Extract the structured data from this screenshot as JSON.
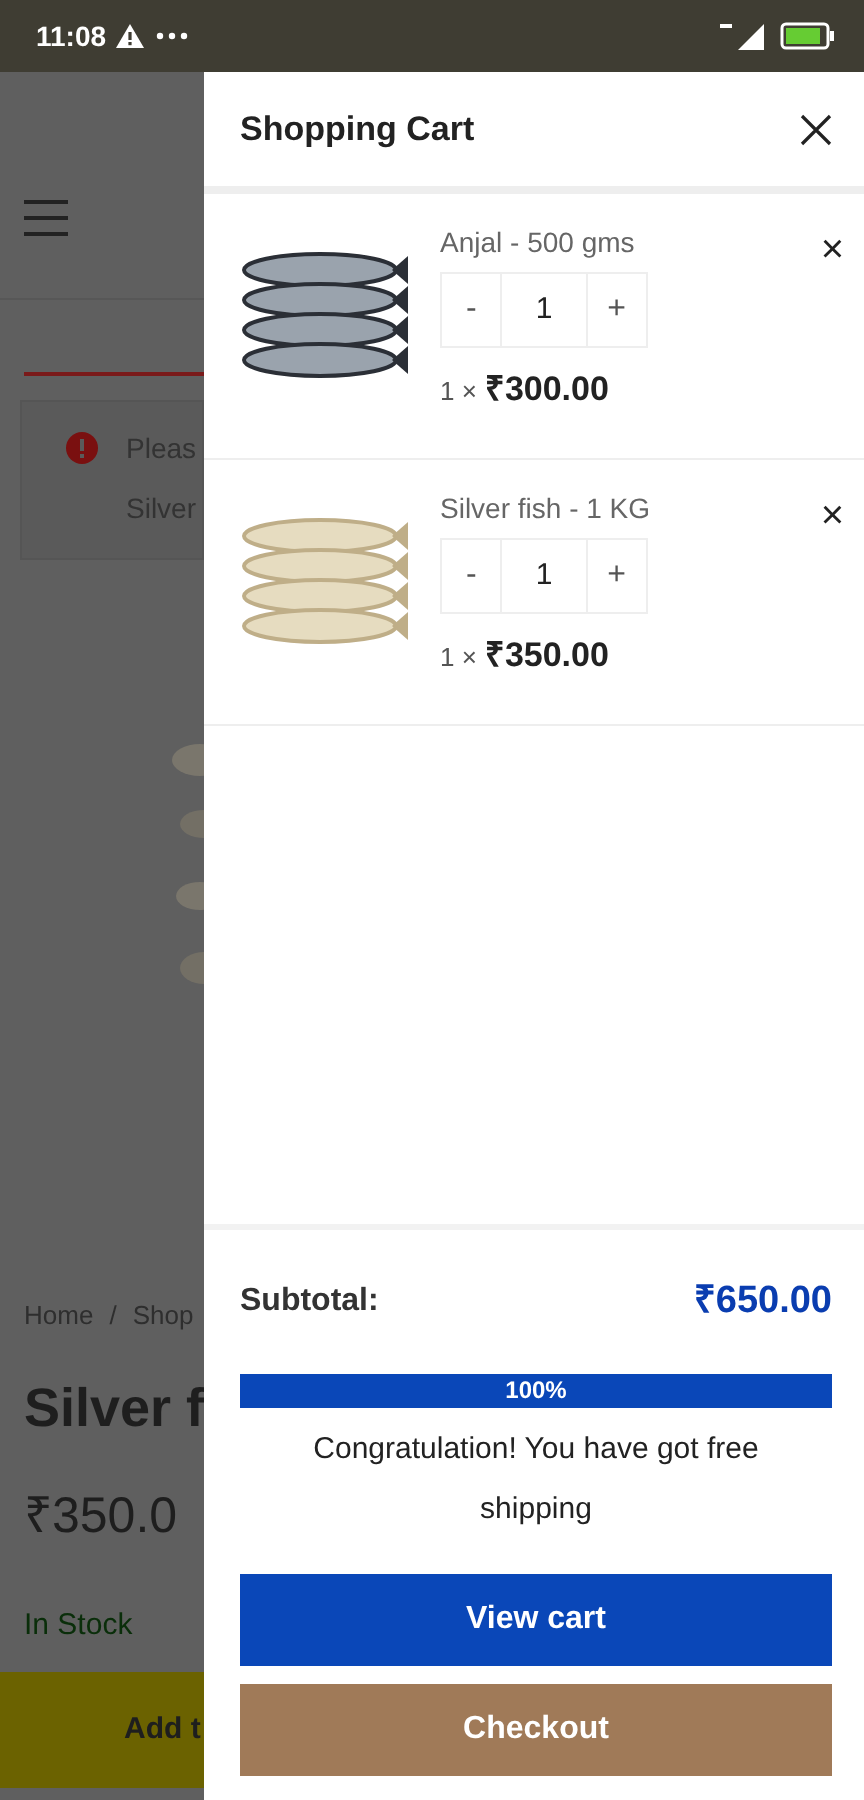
{
  "status_bar": {
    "time": "11:08"
  },
  "background_page": {
    "notice_lines": [
      "Pleas",
      "Silver"
    ],
    "breadcrumb": [
      "Home",
      "/",
      "Shop"
    ],
    "title": "Silver f",
    "price": "₹350.0",
    "stock": "In Stock",
    "button": "Add t"
  },
  "cart": {
    "title": "Shopping Cart",
    "items": [
      {
        "name": "Anjal - 500 gms",
        "decrement": "-",
        "quantity": "1",
        "increment": "+",
        "quantity_label": "1 ×",
        "price": "₹300.00",
        "remove": "×"
      },
      {
        "name": "Silver fish - 1 KG",
        "decrement": "-",
        "quantity": "1",
        "increment": "+",
        "quantity_label": "1 ×",
        "price": "₹350.00",
        "remove": "×"
      }
    ],
    "subtotal_label": "Subtotal:",
    "subtotal": "₹650.00",
    "progress": {
      "level": 1,
      "label": "100%"
    },
    "message": "Congratulation! You have got free shipping",
    "buttons": [
      {
        "label": "View cart",
        "kind": "primary"
      },
      {
        "label": "Checkout",
        "kind": "secondary"
      }
    ]
  }
}
